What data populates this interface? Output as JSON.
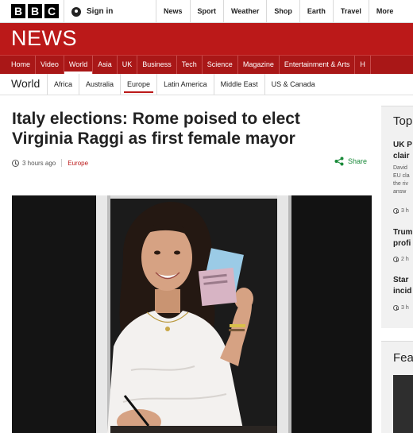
{
  "brand": {
    "letters": [
      "B",
      "B",
      "C"
    ],
    "signin_label": "Sign in"
  },
  "top_nav": [
    "News",
    "Sport",
    "Weather",
    "Shop",
    "Earth",
    "Travel",
    "More"
  ],
  "banner": {
    "title": "NEWS"
  },
  "section_nav": [
    "Home",
    "Video",
    "World",
    "Asia",
    "UK",
    "Business",
    "Tech",
    "Science",
    "Magazine",
    "Entertainment & Arts",
    "H"
  ],
  "section_active": "World",
  "subnav": {
    "section_title": "World",
    "items": [
      "Africa",
      "Australia",
      "Europe",
      "Latin America",
      "Middle East",
      "US & Canada"
    ],
    "active": "Europe"
  },
  "article": {
    "headline": "Italy elections: Rome poised to elect Virginia Raggi as first female mayor",
    "time": "3 hours ago",
    "region": "Europe",
    "share_label": "Share"
  },
  "sidebar": {
    "top_title": "Top",
    "stories": [
      {
        "title_lines": [
          "UK P",
          "clair"
        ],
        "summary_lines": [
          "David",
          "EU cla",
          "the riv",
          "answ"
        ],
        "time": "3 h"
      },
      {
        "title_lines": [
          "Trum",
          "profi"
        ],
        "summary_lines": [],
        "time": "2 h"
      },
      {
        "title_lines": [
          "Star",
          "incid"
        ],
        "summary_lines": [],
        "time": "3 h"
      }
    ],
    "feature_title": "Fea"
  },
  "colors": {
    "brand_red": "#bb1919",
    "section_red": "#a91717",
    "share_green": "#1a8a3a"
  }
}
